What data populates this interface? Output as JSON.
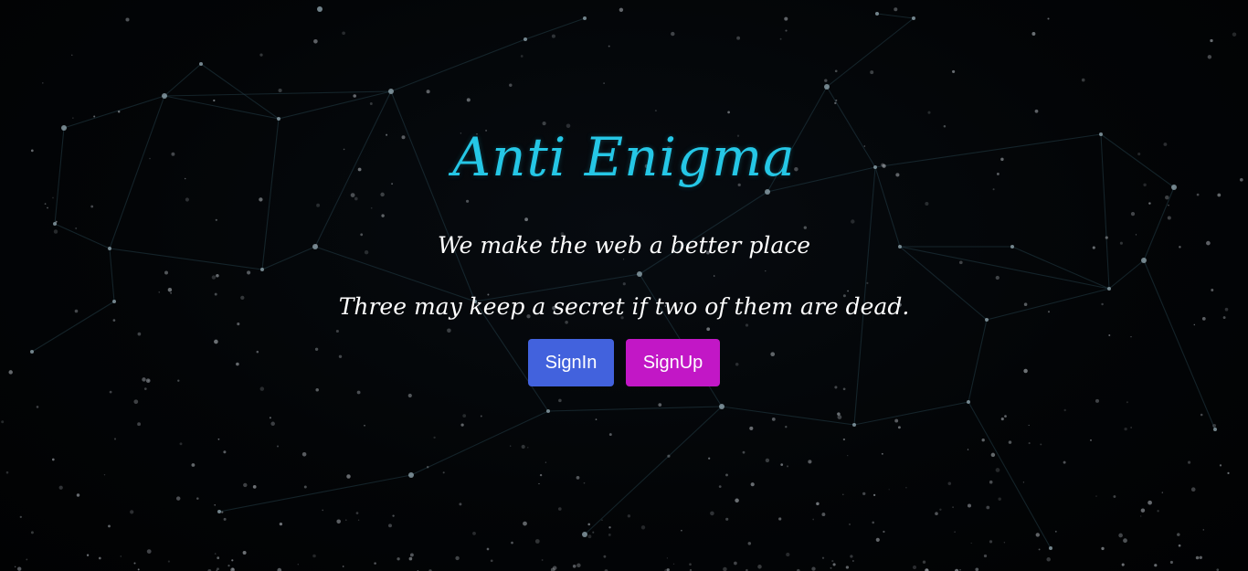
{
  "hero": {
    "title": "Anti Enigma",
    "tagline": "We make the web a better place",
    "quote": "Three may keep a secret if two of them are dead."
  },
  "actions": {
    "signin_label": "SignIn",
    "signup_label": "SignUp"
  },
  "colors": {
    "background": "#020305",
    "title": "#25c7e6",
    "signin_button": "#4262dd",
    "signup_button": "#c217c6",
    "text": "#ffffff"
  },
  "icons": {
    "background": "network-particles-background"
  }
}
